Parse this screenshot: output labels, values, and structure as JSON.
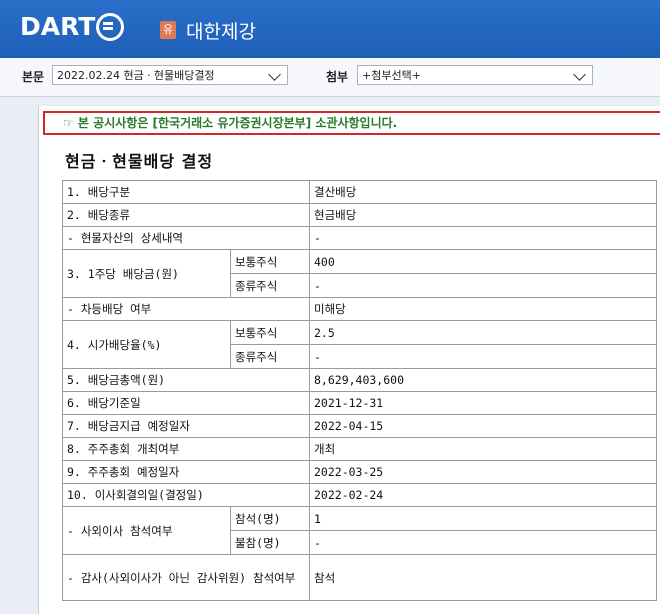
{
  "header": {
    "logo": "DART",
    "badge": "유",
    "company": "대한제강"
  },
  "toolbar": {
    "main_label": "본문",
    "main_select": "2022.02.24  현금ㆍ현물배당결정",
    "attach_label": "첨부",
    "attach_select": "+첨부선택+"
  },
  "notice": "☞ 본 공시사항은 [한국거래소 유가증권시장본부] 소관사항입니다.",
  "title": "현금ㆍ현물배당 결정",
  "rows": [
    {
      "label": "1. 배당구분",
      "value": "결산배당"
    },
    {
      "label": "2. 배당종류",
      "value": "현금배당"
    },
    {
      "label": "- 현물자산의 상세내역",
      "value": "-"
    },
    {
      "label": "3. 1주당 배당금(원)",
      "sub": [
        {
          "label": "보통주식",
          "value": "400"
        },
        {
          "label": "종류주식",
          "value": "-"
        }
      ]
    },
    {
      "label": "- 차등배당 여부",
      "value": "미해당"
    },
    {
      "label": "4. 시가배당율(%)",
      "sub": [
        {
          "label": "보통주식",
          "value": "2.5"
        },
        {
          "label": "종류주식",
          "value": "-"
        }
      ]
    },
    {
      "label": "5. 배당금총액(원)",
      "value": "8,629,403,600"
    },
    {
      "label": "6. 배당기준일",
      "value": "2021-12-31"
    },
    {
      "label": "7. 배당금지급 예정일자",
      "value": "2022-04-15"
    },
    {
      "label": "8. 주주총회 개최여부",
      "value": "개최"
    },
    {
      "label": "9. 주주총회 예정일자",
      "value": "2022-03-25"
    },
    {
      "label": "10. 이사회결의일(결정일)",
      "value": "2022-02-24"
    },
    {
      "label": "- 사외이사 참석여부",
      "sub": [
        {
          "label": "참석(명)",
          "value": "1"
        },
        {
          "label": "불참(명)",
          "value": "-"
        }
      ]
    },
    {
      "label": "- 감사(사외이사가 아닌 감사위원) 참석여부",
      "value": "참석"
    }
  ]
}
